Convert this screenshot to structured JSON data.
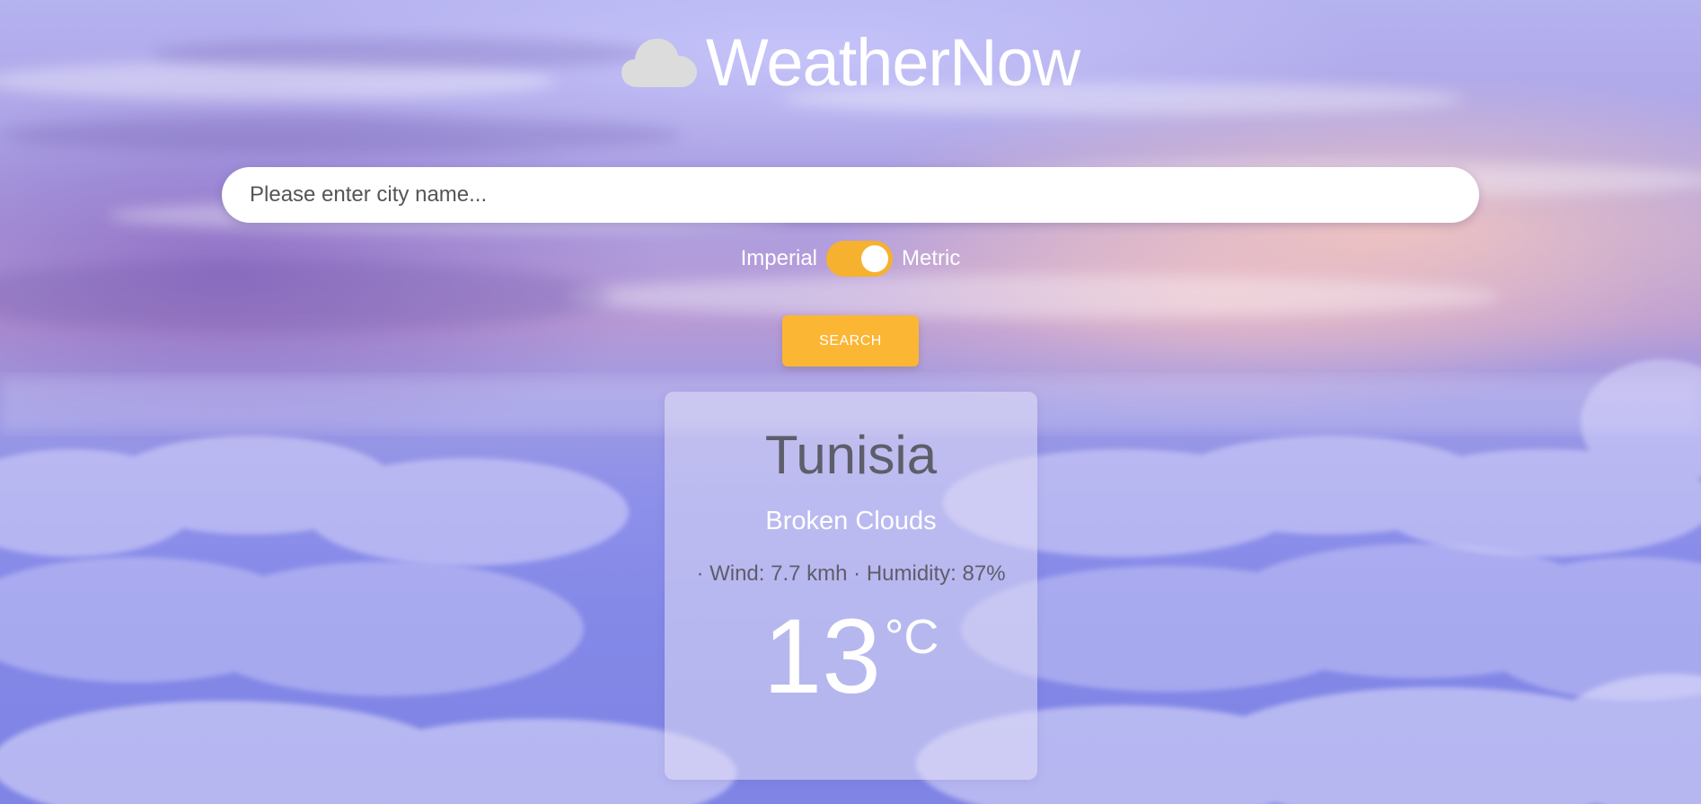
{
  "header": {
    "title": "WeatherNow",
    "logo_icon": "cloud-icon"
  },
  "search": {
    "placeholder": "Please enter city name...",
    "value": "",
    "button_label": "SEARCH"
  },
  "units": {
    "left_label": "Imperial",
    "right_label": "Metric",
    "selected": "Metric",
    "toggle_color": "#f6b12e"
  },
  "weather": {
    "city": "Tunisia",
    "condition": "Broken Clouds",
    "details": "· Wind: 7.7 kmh · Humidity: 87%",
    "temperature": "13",
    "unit": "°C"
  },
  "colors": {
    "accent": "#fbb634",
    "text_dark": "#5e5d6a",
    "text_light": "#ffffff"
  }
}
